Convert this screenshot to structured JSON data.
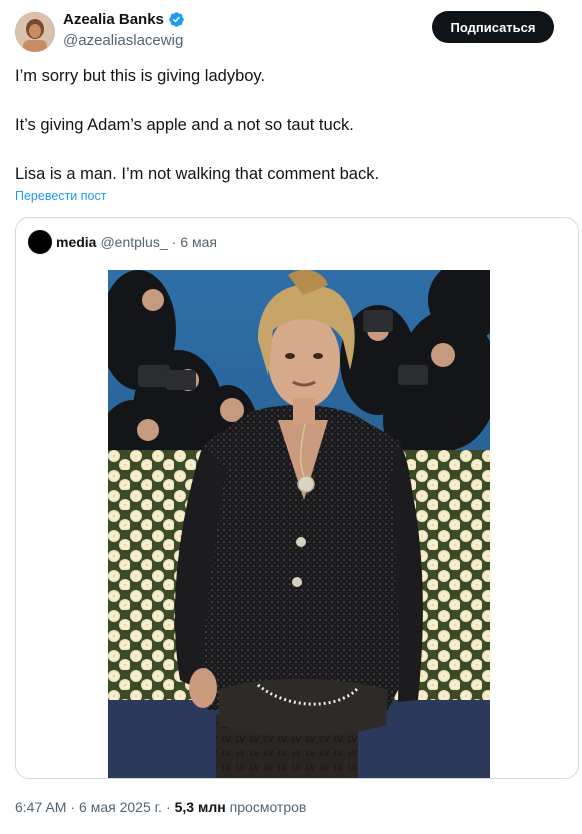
{
  "author": {
    "name": "Azealia Banks",
    "handle": "@azealiaslacewig"
  },
  "actions": {
    "subscribe_label": "Подписаться"
  },
  "tweet": {
    "paragraphs": [
      "I’m sorry but this is giving ladyboy.",
      "It’s giving Adam’s apple and a not so taut tuck.",
      "Lisa is a man. I’m not walking that comment back."
    ],
    "translate_label": "Перевести пост"
  },
  "quoted": {
    "name": "media",
    "handle": "@entplus_",
    "separator": "·",
    "date": "6 мая",
    "image_icon": "photo-of-woman-on-red-carpet"
  },
  "meta": {
    "time": "6:47 AM",
    "separator1": "·",
    "date": "6 мая 2025 г.",
    "separator2": "·",
    "views_count": "5,3 млн",
    "views_label": "просмотров"
  },
  "colors": {
    "accent": "#1d9bf0",
    "text": "#0f1419",
    "secondary": "#536471",
    "border": "#cfd9de",
    "button_bg": "#0f1419"
  }
}
